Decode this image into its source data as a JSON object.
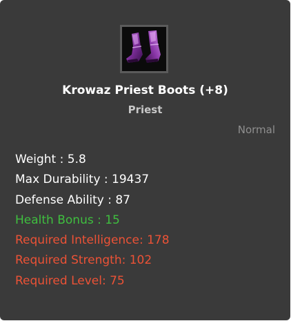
{
  "item": {
    "icon": "purple-priest-boots-icon",
    "name": "Krowaz Priest Boots (+8)",
    "class": "Priest",
    "grade": "Normal"
  },
  "stats": [
    {
      "text": "Weight : 5.8",
      "color": "#ffffff"
    },
    {
      "text": "Max Durability : 19437",
      "color": "#ffffff"
    },
    {
      "text": "Defense Ability : 87",
      "color": "#ffffff"
    },
    {
      "text": "Health Bonus : 15",
      "color": "#3fbf3f"
    },
    {
      "text": "Required Intelligence: 178",
      "color": "#ec5236"
    },
    {
      "text": "Required Strength: 102",
      "color": "#ec5236"
    },
    {
      "text": "Required Level: 75",
      "color": "#ec5236"
    }
  ],
  "colors": {
    "background": "#3a3a3a",
    "bonus": "#3fbf3f",
    "requirement": "#ec5236",
    "grade": "#8f8f8f"
  }
}
